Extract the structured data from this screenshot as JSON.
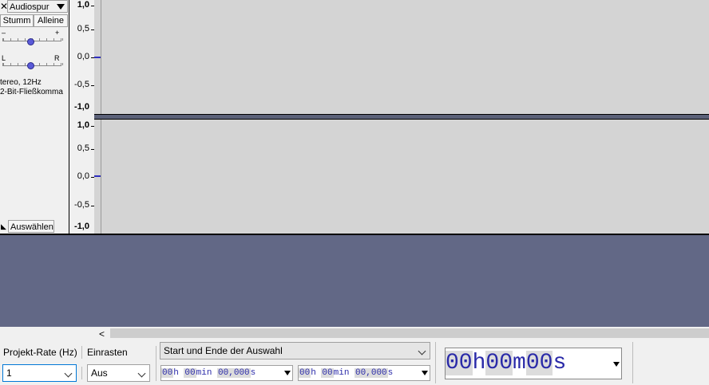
{
  "track": {
    "close_glyph": "✕",
    "name": "Audiospur",
    "mute_label": "Stumm",
    "solo_label": "Alleine",
    "gain_minus": "–",
    "gain_plus": "+",
    "pan_left": "L",
    "pan_right": "R",
    "info_line1": "tereo, 12Hz",
    "info_line2": "2-Bit-Fließkomma",
    "select_label": "Auswählen"
  },
  "ruler": {
    "upper": [
      "1,0",
      "0,5",
      "0,0",
      "-0,5",
      "-1,0"
    ],
    "lower": [
      "1,0",
      "0,5",
      "0,0",
      "-0,5",
      "-1,0"
    ]
  },
  "scrollbar": {
    "left_arrow": "<"
  },
  "toolbar": {
    "project_rate_label": "Projekt-Rate (Hz)",
    "project_rate_value": "1",
    "snap_label": "Einrasten",
    "snap_value": "Aus",
    "selection_mode": "Start und Ende der Auswahl",
    "sel_start": {
      "h": "00",
      "h_unit": "h",
      "m": "00",
      "m_unit": "min",
      "s": "00,000",
      "s_unit": "s"
    },
    "sel_end": {
      "h": "00",
      "h_unit": "h",
      "m": "00",
      "m_unit": "min",
      "s": "00,000",
      "s_unit": "s"
    },
    "position": {
      "h": "00",
      "h_unit": "h",
      "m": "00",
      "m_unit": "m",
      "s": "00",
      "s_unit": "s"
    }
  },
  "colors": {
    "wave_bg": "#d4d4d4",
    "empty_area": "#626886",
    "time_digits": "#2a2aa8"
  }
}
